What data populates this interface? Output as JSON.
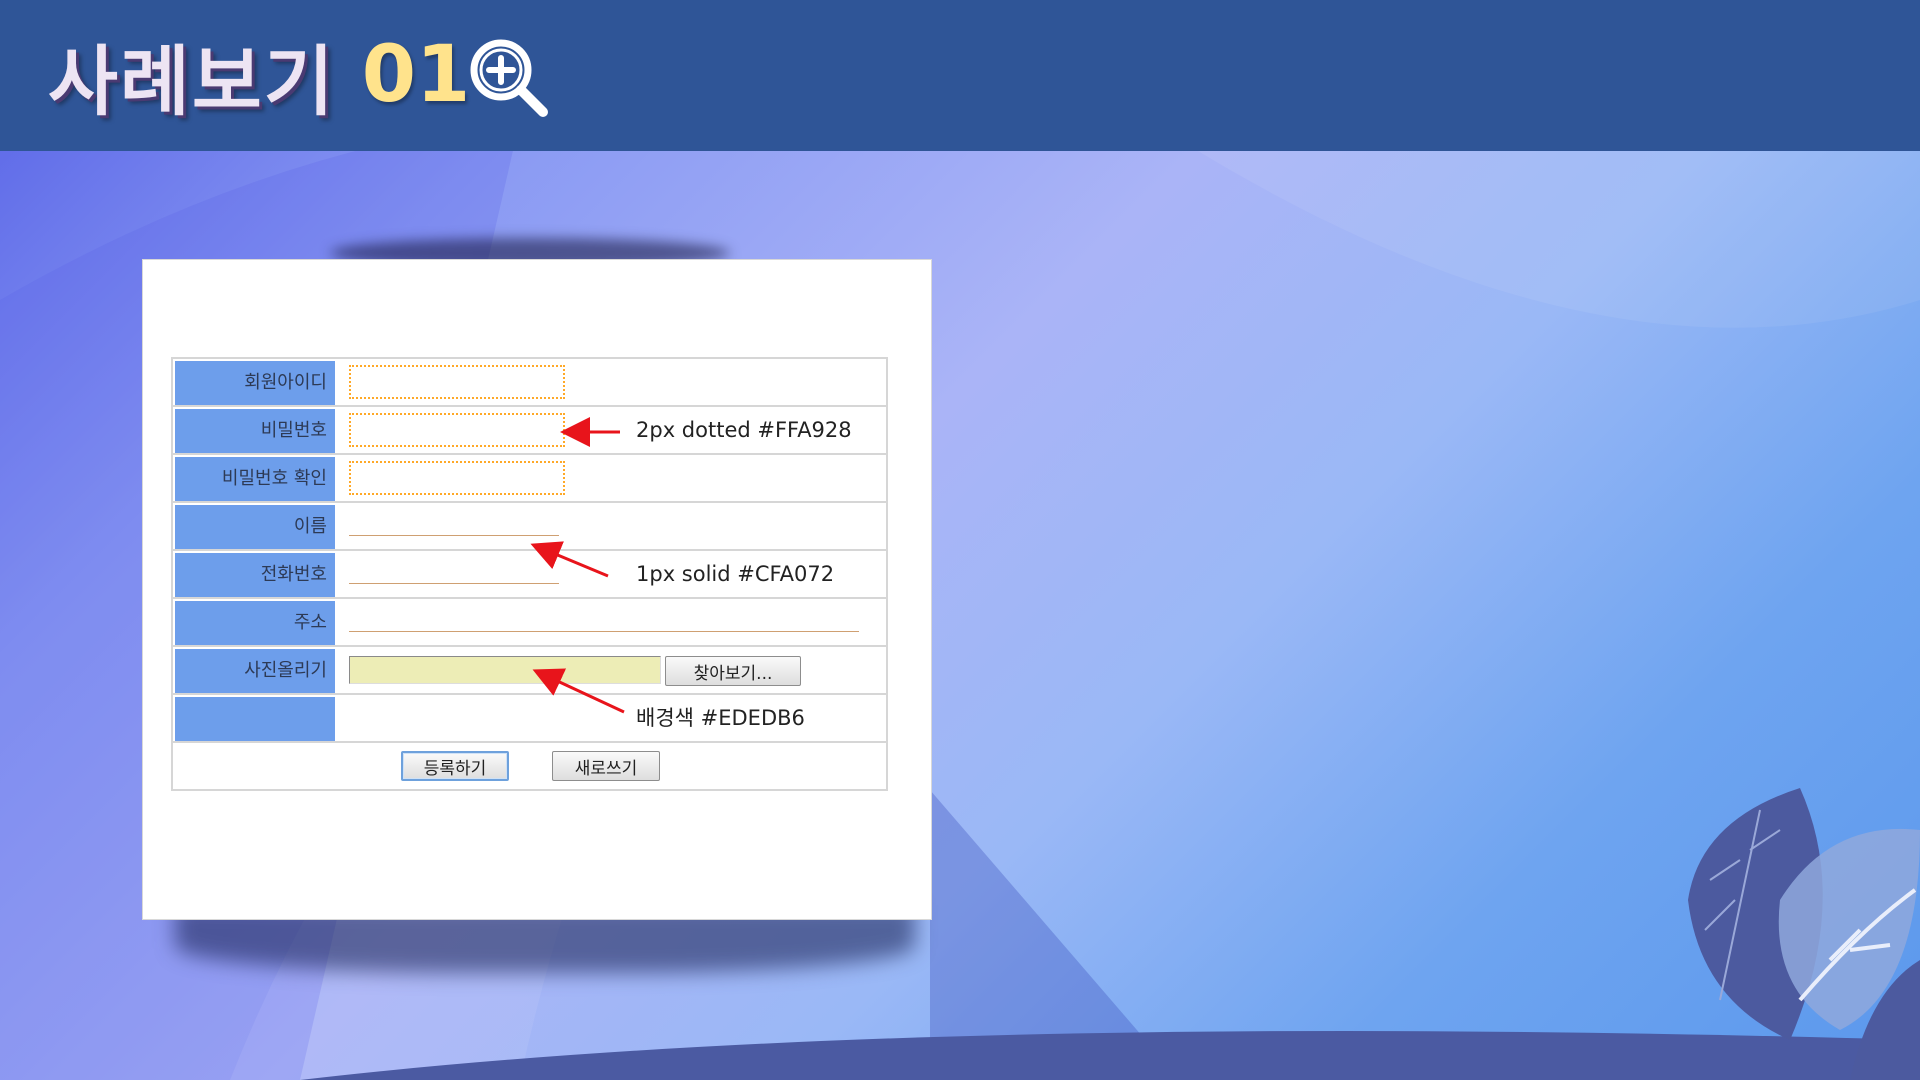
{
  "header": {
    "title": "사례보기",
    "number": "01",
    "icon": "zoom-in-magnifier-icon"
  },
  "form": {
    "rows": [
      {
        "label": "회원아이디",
        "field": "dotted-box"
      },
      {
        "label": "비밀번호",
        "field": "dotted-box"
      },
      {
        "label": "비밀번호 확인",
        "field": "dotted-box"
      },
      {
        "label": "이름",
        "field": "underline"
      },
      {
        "label": "전화번호",
        "field": "underline"
      },
      {
        "label": "주소",
        "field": "underline-long"
      },
      {
        "label": "사진올리기",
        "field": "file"
      },
      {
        "label": "",
        "field": "empty"
      }
    ],
    "browse_button": "찾아보기...",
    "submit_button": "등록하기",
    "reset_button": "새로쓰기"
  },
  "annotations": {
    "dotted": "2px dotted #FFA928",
    "solid": "1px solid #CFA072",
    "background": "배경색 #EDEDB6"
  },
  "colors": {
    "header_bg": "#2f5597",
    "label_bg": "#6d9eeb",
    "dotted_border": "#FFA928",
    "solid_border": "#CFA072",
    "file_bg": "#EDEDB6",
    "arrow": "#e8141b",
    "title_number": "#ffe38c"
  }
}
